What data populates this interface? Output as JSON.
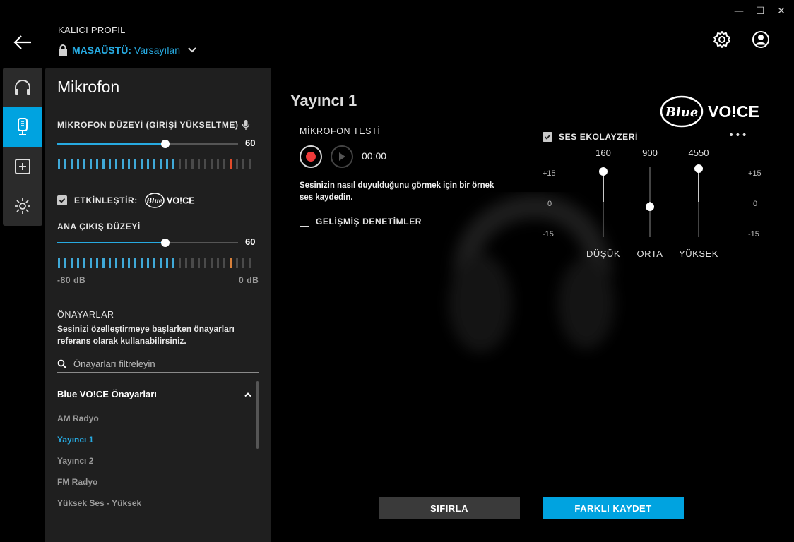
{
  "window": {
    "minimize": "—",
    "maximize": "☐",
    "close": "✕"
  },
  "header": {
    "profile_label": "KALICI PROFIL",
    "profile_prefix": "MASAÜSTÜ:",
    "profile_name": "Varsayılan"
  },
  "nav": {
    "items": [
      "headset-icon",
      "microphone-icon",
      "add-icon",
      "lighting-icon"
    ],
    "active_color": "#00a3e0"
  },
  "panel": {
    "title": "Mikrofon",
    "mic_level_label": "MİKROFON DÜZEYİ (GİRİŞİ YÜKSELTME)",
    "mic_level_value": "60",
    "mic_level_fraction": 0.6,
    "enable_label": "ETKİNLEŞTİR:",
    "enable_checked": true,
    "blue_voice_logo": "Blue VO!CE",
    "output_level_label": "ANA ÇIKIŞ DÜZEYİ",
    "output_level_value": "60",
    "output_level_fraction": 0.6,
    "db_min": "-80 dB",
    "db_max": "0 dB",
    "presets_label": "ÖNAYARLAR",
    "presets_desc": "Sesinizi özelleştirmeye başlarken önayarları referans olarak kullanabilirsiniz.",
    "search_placeholder": "Önayarları filtreleyin",
    "preset_group": "Blue VO!CE Önayarları",
    "presets": [
      "AM Radyo",
      "Yayıncı 1",
      "Yayıncı 2",
      "FM Radyo",
      "Yüksek Ses - Yüksek"
    ],
    "active_preset": "Yayıncı 1"
  },
  "main": {
    "title": "Yayıncı 1",
    "mic_test_label": "MİKROFON TESTİ",
    "timer": "00:00",
    "help_text": "Sesinizin nasıl duyulduğunu görmek için bir örnek ses kaydedin.",
    "advanced_label": "GELİŞMİŞ DENETİMLER",
    "brand_logo": "Blue VO!CE",
    "eq_label": "SES EKOLAYZERİ",
    "eq_more": "•••",
    "eq_scale_top": "+15",
    "eq_scale_mid": "0",
    "eq_scale_bottom": "-15",
    "eq_bands": [
      {
        "freq": "160",
        "name": "DÜŞÜK",
        "gain": 13
      },
      {
        "freq": "900",
        "name": "ORTA",
        "gain": -2
      },
      {
        "freq": "4550",
        "name": "YÜKSEK",
        "gain": 14
      }
    ],
    "reset_label": "SIFIRLA",
    "save_as_label": "FARKLI KAYDET"
  }
}
